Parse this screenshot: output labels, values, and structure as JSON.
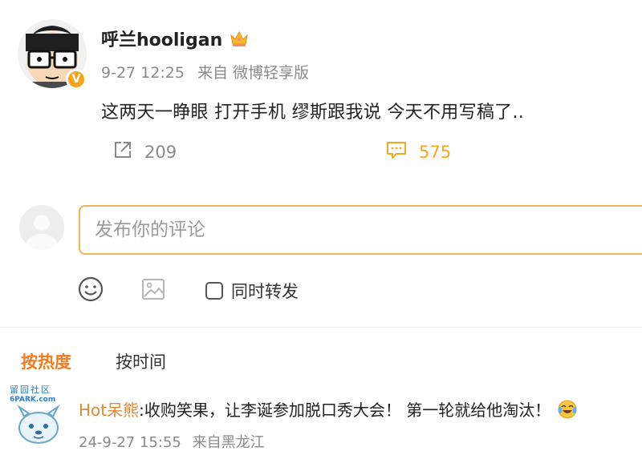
{
  "post": {
    "username": "呼兰hooligan",
    "verified_badge": "V",
    "time": "9-27 12:25",
    "source": "来自 微博轻享版",
    "content": "这两天一睁眼 打开手机 缪斯跟我说 今天不用写稿了..",
    "share_count": "209",
    "comment_count": "575",
    "icons": {
      "crown": "crown-icon",
      "share": "share-icon",
      "comment": "comment-icon"
    }
  },
  "composer": {
    "placeholder": "发布你的评论",
    "repost_label": "同时转发",
    "icons": {
      "emoji": "emoji-icon",
      "image": "image-icon"
    }
  },
  "tabs": {
    "hot": "按热度",
    "time": "按时间"
  },
  "hot_comment": {
    "author": "Hot呆熊",
    "text": ":收购笑果，让李诞参加脱口秀大会！ 第一轮就给他淘汰！",
    "time": "24-9-27 15:55",
    "source": "来自黑龙江",
    "emoji": "laughing-crying-icon"
  },
  "watermark": {
    "text": "留园社区",
    "site": "6PARK.com"
  },
  "colors": {
    "accent_orange": "#f27b20",
    "comment_orange": "#f5a623",
    "input_border": "#f0b45a",
    "meta_gray": "#8a8a8a"
  }
}
